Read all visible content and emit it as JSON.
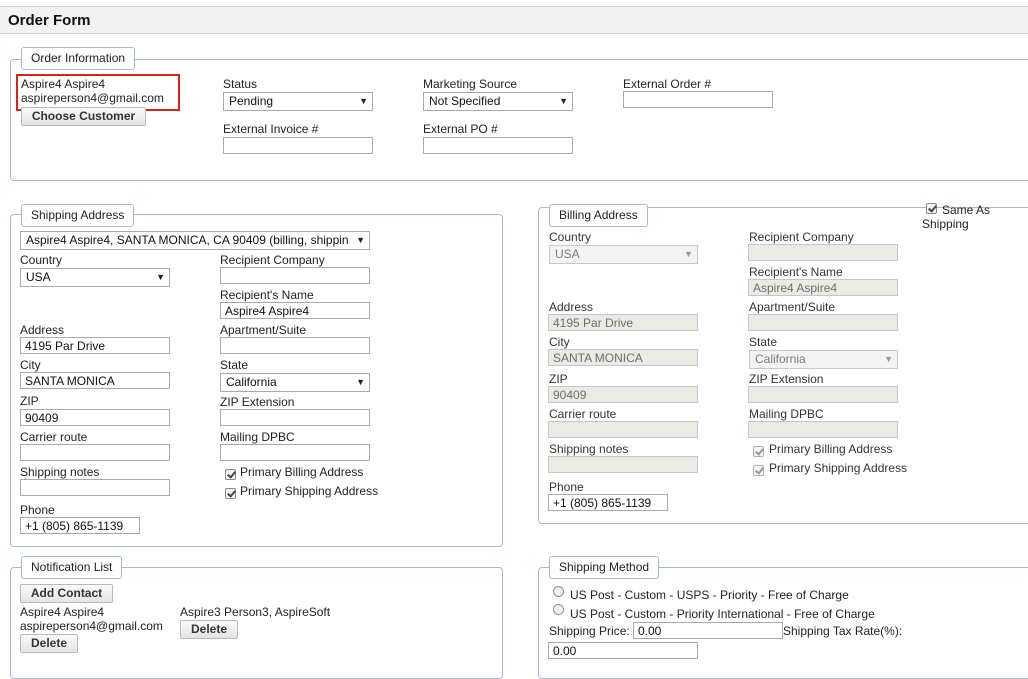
{
  "page": {
    "title": "Order Form"
  },
  "order_info": {
    "legend": "Order Information",
    "customer_name": "Aspire4 Aspire4",
    "customer_email": "aspireperson4@gmail.com",
    "choose_customer": "Choose Customer",
    "status_label": "Status",
    "status_value": "Pending",
    "marketing_label": "Marketing Source",
    "marketing_value": "Not Specified",
    "ext_order_label": "External Order #",
    "ext_order_value": "",
    "ext_invoice_label": "External Invoice #",
    "ext_invoice_value": "",
    "ext_po_label": "External PO #",
    "ext_po_value": ""
  },
  "shipping": {
    "legend": "Shipping Address",
    "address_select": "Aspire4 Aspire4, SANTA MONICA, CA 90409 (billing, shippin",
    "country_label": "Country",
    "country_value": "USA",
    "recipient_company_label": "Recipient Company",
    "recipient_company_value": "",
    "recipient_name_label": "Recipient's Name",
    "recipient_name_value": "Aspire4 Aspire4",
    "address_label": "Address",
    "address_value": "4195 Par Drive",
    "apt_label": "Apartment/Suite",
    "apt_value": "",
    "city_label": "City",
    "city_value": "SANTA MONICA",
    "state_label": "State",
    "state_value": "California",
    "zip_label": "ZIP",
    "zip_value": "90409",
    "zip_ext_label": "ZIP Extension",
    "zip_ext_value": "",
    "carrier_label": "Carrier route",
    "carrier_value": "",
    "dpbc_label": "Mailing DPBC",
    "dpbc_value": "",
    "notes_label": "Shipping notes",
    "notes_value": "",
    "primary_billing": "Primary Billing Address",
    "primary_shipping": "Primary Shipping Address",
    "phone_label": "Phone",
    "phone_value": "+1 (805) 865-1139"
  },
  "billing": {
    "legend": "Billing Address",
    "same_as": "Same As",
    "shipping_word": "Shipping",
    "country_label": "Country",
    "country_value": "USA",
    "recipient_company_label": "Recipient Company",
    "recipient_company_value": "",
    "recipient_name_label": "Recipient's Name",
    "recipient_name_value": "Aspire4 Aspire4",
    "address_label": "Address",
    "address_value": "4195 Par Drive",
    "apt_label": "Apartment/Suite",
    "apt_value": "",
    "city_label": "City",
    "city_value": "SANTA MONICA",
    "state_label": "State",
    "state_value": "California",
    "zip_label": "ZIP",
    "zip_value": "90409",
    "zip_ext_label": "ZIP Extension",
    "zip_ext_value": "",
    "carrier_label": "Carrier route",
    "carrier_value": "",
    "dpbc_label": "Mailing DPBC",
    "dpbc_value": "",
    "notes_label": "Shipping notes",
    "notes_value": "",
    "primary_billing": "Primary Billing Address",
    "primary_shipping": "Primary Shipping Address",
    "phone_label": "Phone",
    "phone_value": "+1 (805) 865-1139"
  },
  "notifications": {
    "legend": "Notification List",
    "add_contact": "Add Contact",
    "contact1_name": "Aspire4 Aspire4",
    "contact1_email": "aspireperson4@gmail.com",
    "contact2_name": "Aspire3 Person3, AspireSoft",
    "delete": "Delete"
  },
  "shipping_method": {
    "legend": "Shipping Method",
    "option1": "US Post - Custom - USPS - Priority - Free of Charge",
    "option2": "US Post - Custom - Priority International - Free of Charge",
    "price_label": "Shipping Price:",
    "price_value": "0.00",
    "tax_label": "Shipping Tax Rate(%):",
    "tax_value": "0.00"
  }
}
